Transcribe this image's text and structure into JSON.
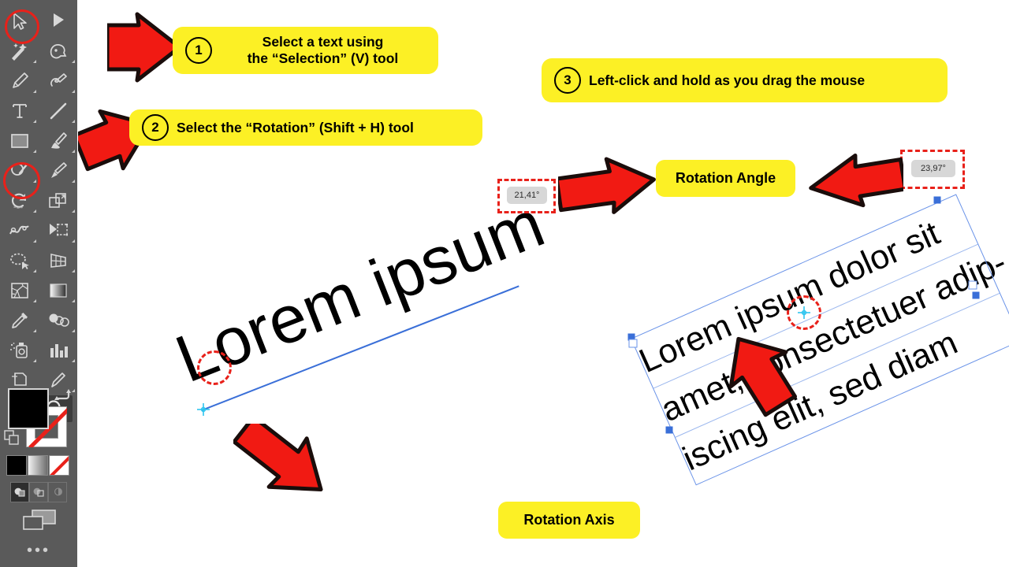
{
  "app": {
    "canvas_background": "#ffffff",
    "toolbar_background": "#5a5a5a",
    "accent_yellow": "#fcf025",
    "accent_red": "#e8211a",
    "selection_blue": "#3a6fd8"
  },
  "toolbar": {
    "tools": [
      {
        "name": "selection-tool",
        "row": 0,
        "col": 0,
        "highlighted": true
      },
      {
        "name": "node-tool",
        "row": 0,
        "col": 1,
        "highlighted": false
      },
      {
        "name": "tweak-tool",
        "row": 1,
        "col": 0,
        "highlighted": false
      },
      {
        "name": "zoom-marquee-tool",
        "row": 1,
        "col": 1,
        "highlighted": false
      },
      {
        "name": "pen-tool",
        "row": 2,
        "col": 0,
        "highlighted": false
      },
      {
        "name": "pencil-tool",
        "row": 2,
        "col": 1,
        "highlighted": false
      },
      {
        "name": "text-tool",
        "row": 3,
        "col": 0,
        "highlighted": false
      },
      {
        "name": "line-tool",
        "row": 3,
        "col": 1,
        "highlighted": false
      },
      {
        "name": "rectangle-tool",
        "row": 4,
        "col": 0,
        "highlighted": false
      },
      {
        "name": "brush-tool",
        "row": 4,
        "col": 1,
        "highlighted": false
      },
      {
        "name": "shape-builder-tool",
        "row": 5,
        "col": 0,
        "highlighted": false
      },
      {
        "name": "paintbrush-tool",
        "row": 5,
        "col": 1,
        "highlighted": false
      },
      {
        "name": "rotation-tool",
        "row": 6,
        "col": 0,
        "highlighted": true
      },
      {
        "name": "transform-tool",
        "row": 6,
        "col": 1,
        "highlighted": false
      },
      {
        "name": "warp-tool",
        "row": 7,
        "col": 0,
        "highlighted": false
      },
      {
        "name": "mesh-tool",
        "row": 7,
        "col": 1,
        "highlighted": false
      },
      {
        "name": "lasso-tool",
        "row": 8,
        "col": 0,
        "highlighted": false
      },
      {
        "name": "perspective-tool",
        "row": 8,
        "col": 1,
        "highlighted": false
      },
      {
        "name": "crackle-fill-tool",
        "row": 9,
        "col": 0,
        "highlighted": false
      },
      {
        "name": "gradient-tool",
        "row": 9,
        "col": 1,
        "highlighted": false
      },
      {
        "name": "eyedropper-tool",
        "row": 10,
        "col": 0,
        "highlighted": false
      },
      {
        "name": "blend-tool",
        "row": 10,
        "col": 1,
        "highlighted": false
      },
      {
        "name": "spray-tool",
        "row": 11,
        "col": 0,
        "highlighted": false
      },
      {
        "name": "chart-tool",
        "row": 11,
        "col": 1,
        "highlighted": false
      },
      {
        "name": "artboard-tool",
        "row": 12,
        "col": 0,
        "highlighted": false
      },
      {
        "name": "slice-tool",
        "row": 12,
        "col": 1,
        "highlighted": false
      },
      {
        "name": "hand-tool",
        "row": 13,
        "col": 0,
        "highlighted": false
      },
      {
        "name": "zoom-tool",
        "row": 13,
        "col": 1,
        "highlighted": false,
        "selected": true
      }
    ],
    "swatches": {
      "fill_color": "#000000",
      "stroke_color": "#ffffff",
      "stroke_is_none": true
    },
    "mode_buttons": [
      "solid-color",
      "gradient",
      "none"
    ],
    "blend_buttons": [
      "normal-blend",
      "overlay-blend",
      "screen-blend"
    ],
    "overflow_label": "•••"
  },
  "callouts": [
    {
      "id": "callout-1",
      "number": "1",
      "text": "Select a text using\nthe “Selection” (V) tool",
      "line1": "Select a text using",
      "line2": "the “Selection” (V) tool"
    },
    {
      "id": "callout-2",
      "number": "2",
      "text": "Select the “Rotation” (Shift + H) tool"
    },
    {
      "id": "callout-3",
      "number": "3",
      "text": "Left-click and hold as you drag the mouse"
    }
  ],
  "labels": {
    "rotation_angle": "Rotation Angle",
    "rotation_axis": "Rotation Axis"
  },
  "angle_readouts": [
    {
      "id": "angle-readout-left",
      "value": "21,41°"
    },
    {
      "id": "angle-readout-right",
      "value": "23,97°"
    }
  ],
  "canvas_objects": {
    "left_text": {
      "content": "Lorem ipsum",
      "rotation_degrees": -21.41
    },
    "right_text": {
      "lines": [
        "Lorem ipsum dolor sit",
        "amet, consectetuer adip-",
        "iscing elit, sed diam"
      ],
      "rotation_degrees": -23.97
    }
  },
  "arrows": [
    {
      "name": "arrow-to-selection-tool",
      "direction": "left"
    },
    {
      "name": "arrow-to-rotation-tool",
      "direction": "upper-left"
    },
    {
      "name": "arrow-to-rotation-axis-left",
      "direction": "lower-right"
    },
    {
      "name": "arrow-to-angle-readout-left",
      "direction": "left"
    },
    {
      "name": "arrow-to-angle-readout-right",
      "direction": "right"
    },
    {
      "name": "arrow-to-rotation-axis-right",
      "direction": "lower-left"
    }
  ]
}
